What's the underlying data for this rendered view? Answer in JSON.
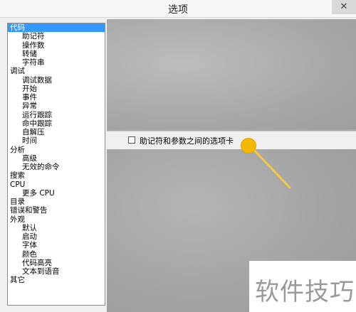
{
  "window": {
    "title": "选项",
    "close_glyph": "✕"
  },
  "tree": {
    "items": [
      {
        "label": "代码",
        "level": 0,
        "selected": true
      },
      {
        "label": "助记符",
        "level": 1
      },
      {
        "label": "操作数",
        "level": 1
      },
      {
        "label": "转储",
        "level": 1
      },
      {
        "label": "字符串",
        "level": 1
      },
      {
        "label": "调试",
        "level": 0
      },
      {
        "label": "调试数据",
        "level": 1
      },
      {
        "label": "开始",
        "level": 1
      },
      {
        "label": "事件",
        "level": 1
      },
      {
        "label": "异常",
        "level": 1
      },
      {
        "label": "运行跟踪",
        "level": 1
      },
      {
        "label": "命中跟踪",
        "level": 1
      },
      {
        "label": "自解压",
        "level": 1
      },
      {
        "label": "时间",
        "level": 1
      },
      {
        "label": "分析",
        "level": 0
      },
      {
        "label": "高级",
        "level": 1
      },
      {
        "label": "无效的命令",
        "level": 1
      },
      {
        "label": "搜索",
        "level": 0
      },
      {
        "label": "CPU",
        "level": 0
      },
      {
        "label": "更多 CPU",
        "level": 1
      },
      {
        "label": "目录",
        "level": 0
      },
      {
        "label": "错误和警告",
        "level": 0
      },
      {
        "label": "外观",
        "level": 0
      },
      {
        "label": "默认",
        "level": 1
      },
      {
        "label": "启动",
        "level": 1
      },
      {
        "label": "字体",
        "level": 1
      },
      {
        "label": "颜色",
        "level": 1
      },
      {
        "label": "代码高亮",
        "level": 1
      },
      {
        "label": "文本到语音",
        "level": 1
      },
      {
        "label": "其它",
        "level": 0
      }
    ]
  },
  "panel": {
    "option": {
      "label": "助记符和参数之间的选项卡",
      "checked": false
    }
  },
  "watermark": {
    "text": "软件技巧"
  },
  "colors": {
    "selection": "#3399ff",
    "cursor_highlight": "#f5b800"
  }
}
